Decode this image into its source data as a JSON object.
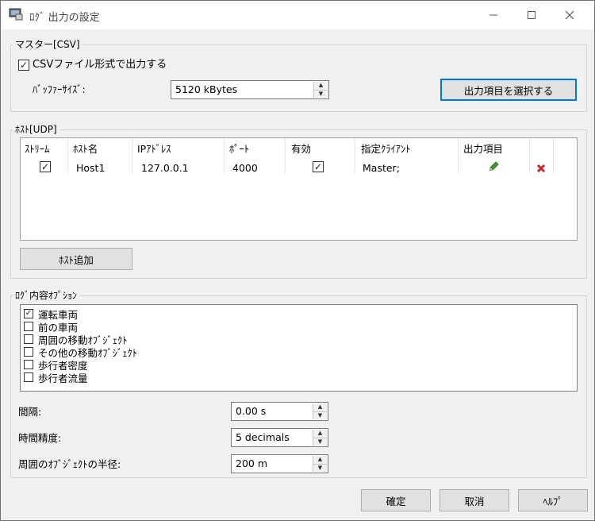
{
  "window": {
    "title": "ﾛｸﾞ 出力の設定"
  },
  "icons": {
    "pencil_color": "#3c9b29",
    "delete_color": "#c1272d",
    "accent": "#0078d7"
  },
  "master": {
    "legend": "マスター[CSV]",
    "csv_output_label": "CSVファイル形式で出力する",
    "csv_output_checked": true,
    "buffer_size_label": "ﾊﾞｯﾌｧｰｻｲｽﾞ:",
    "buffer_size_value": "5120 kBytes",
    "select_items_button": "出力項目を選択する"
  },
  "host": {
    "legend": "ﾎｽﾄ[UDP]",
    "columns": [
      "ｽﾄﾘｰﾑ",
      "ﾎｽﾄ名",
      "IPｱﾄﾞﾚｽ",
      "ﾎﾟｰﾄ",
      "有効",
      "指定ｸﾗｲｱﾝﾄ",
      "出力項目"
    ],
    "rows": [
      {
        "stream": true,
        "host_name": "Host1",
        "ip": "127.0.0.1",
        "port": "4000",
        "enabled": true,
        "client": "Master;"
      }
    ],
    "add_host_button": "ﾎｽﾄ追加"
  },
  "log_options": {
    "legend": "ﾛｸﾞ内容ｵﾌﾟｼｮﾝ",
    "items": [
      {
        "label": "運転車両",
        "checked": true
      },
      {
        "label": "前の車両",
        "checked": false
      },
      {
        "label": "周囲の移動ｵﾌﾞｼﾞｪｸﾄ",
        "checked": false
      },
      {
        "label": "その他の移動ｵﾌﾞｼﾞｪｸﾄ",
        "checked": false
      },
      {
        "label": "歩行者密度",
        "checked": false
      },
      {
        "label": "歩行者流量",
        "checked": false
      }
    ]
  },
  "settings": {
    "interval_label": "間隔:",
    "interval_value": "0.00 s",
    "precision_label": "時間精度:",
    "precision_value": "5 decimals",
    "radius_label": "周囲のｵﾌﾞｼﾞｪｸﾄの半径:",
    "radius_value": "200 m"
  },
  "footer": {
    "ok": "確定",
    "cancel": "取消",
    "help": "ﾍﾙﾌﾟ"
  }
}
